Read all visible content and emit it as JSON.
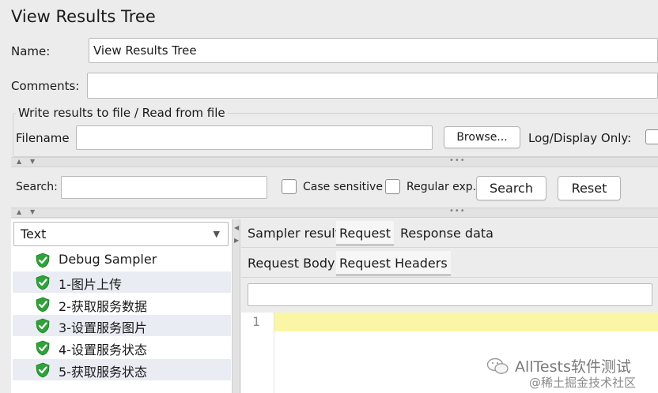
{
  "window": {
    "title": "View Results Tree"
  },
  "form": {
    "name_label": "Name:",
    "name_value": "View Results Tree",
    "comments_label": "Comments:",
    "comments_value": ""
  },
  "file_panel": {
    "legend": "Write results to file / Read from file",
    "filename_label": "Filename",
    "filename_value": "",
    "browse_label": "Browse...",
    "log_display_label": "Log/Display Only:"
  },
  "search": {
    "label": "Search:",
    "value": "",
    "case_sensitive_label": "Case sensitive",
    "regular_exp_label": "Regular exp.",
    "search_button": "Search",
    "reset_button": "Reset"
  },
  "renderer": {
    "selected": "Text"
  },
  "tree": {
    "items": [
      {
        "label": "Debug Sampler",
        "icon": "success-shield-check-icon"
      },
      {
        "label": "1-图片上传",
        "icon": "success-shield-check-icon"
      },
      {
        "label": "2-获取服务数据",
        "icon": "success-shield-check-icon"
      },
      {
        "label": "3-设置服务图片",
        "icon": "success-shield-check-icon"
      },
      {
        "label": "4-设置服务状态",
        "icon": "success-shield-check-icon"
      },
      {
        "label": "5-获取服务状态",
        "icon": "success-shield-check-icon"
      }
    ]
  },
  "result_tabs": {
    "main": [
      "Sampler result",
      "Request",
      "Response data"
    ],
    "main_active": "Request",
    "sub": [
      "Request Body",
      "Request Headers"
    ],
    "sub_active": "Request Headers"
  },
  "editor": {
    "line_number": "1"
  },
  "watermark": {
    "line1": "AllTests软件测试",
    "line2": "@稀土掘金技术社区"
  },
  "colors": {
    "highlight_line": "#fbf6a6",
    "success_green": "#2fa33a",
    "background": "#ececec"
  }
}
